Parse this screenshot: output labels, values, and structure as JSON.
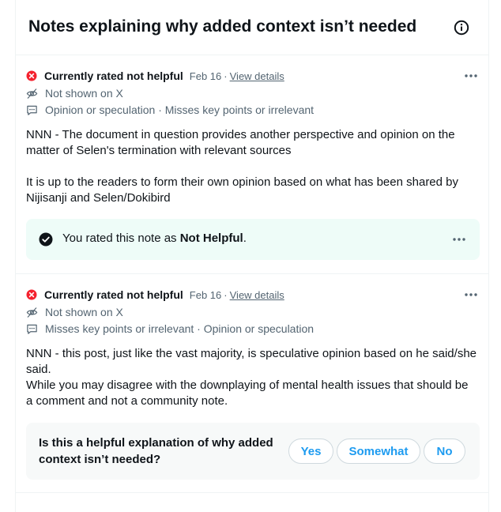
{
  "header": {
    "title": "Notes explaining why added context isn’t needed",
    "info_icon": "info-circle-icon"
  },
  "notes": [
    {
      "status": "Currently rated not helpful",
      "date": "Feb 16",
      "separator": "·",
      "details_link": "View details",
      "visibility": "Not shown on X",
      "reasons": "Opinion or speculation · Misses key points or irrelevant",
      "body": "NNN - The document in question provides another perspective and opinion on the matter of Selen's termination with relevant sources\n\nIt is up to the readers to form their own opinion based on what has been shared by Nijisanji and Selen/Dokibird",
      "rating": {
        "prefix": "You rated this note as ",
        "value": "Not Helpful",
        "suffix": "."
      }
    },
    {
      "status": "Currently rated not helpful",
      "date": "Feb 16",
      "separator": "·",
      "details_link": "View details",
      "visibility": "Not shown on X",
      "reasons": "Misses key points or irrelevant · Opinion or speculation",
      "body": "NNN - this post, just like the vast majority, is speculative opinion based on he said/she said.\nWhile you may disagree with the downplaying of mental health issues that should be a comment and not a community note.",
      "question": "Is this a helpful explanation of why added context isn’t needed?",
      "answers": [
        "Yes",
        "Somewhat",
        "No"
      ]
    }
  ],
  "colors": {
    "status_red": "#f4212e",
    "link_blue": "#1d9bf0",
    "rated_bg": "#eefcf8",
    "question_bg": "#f7f9f9"
  }
}
